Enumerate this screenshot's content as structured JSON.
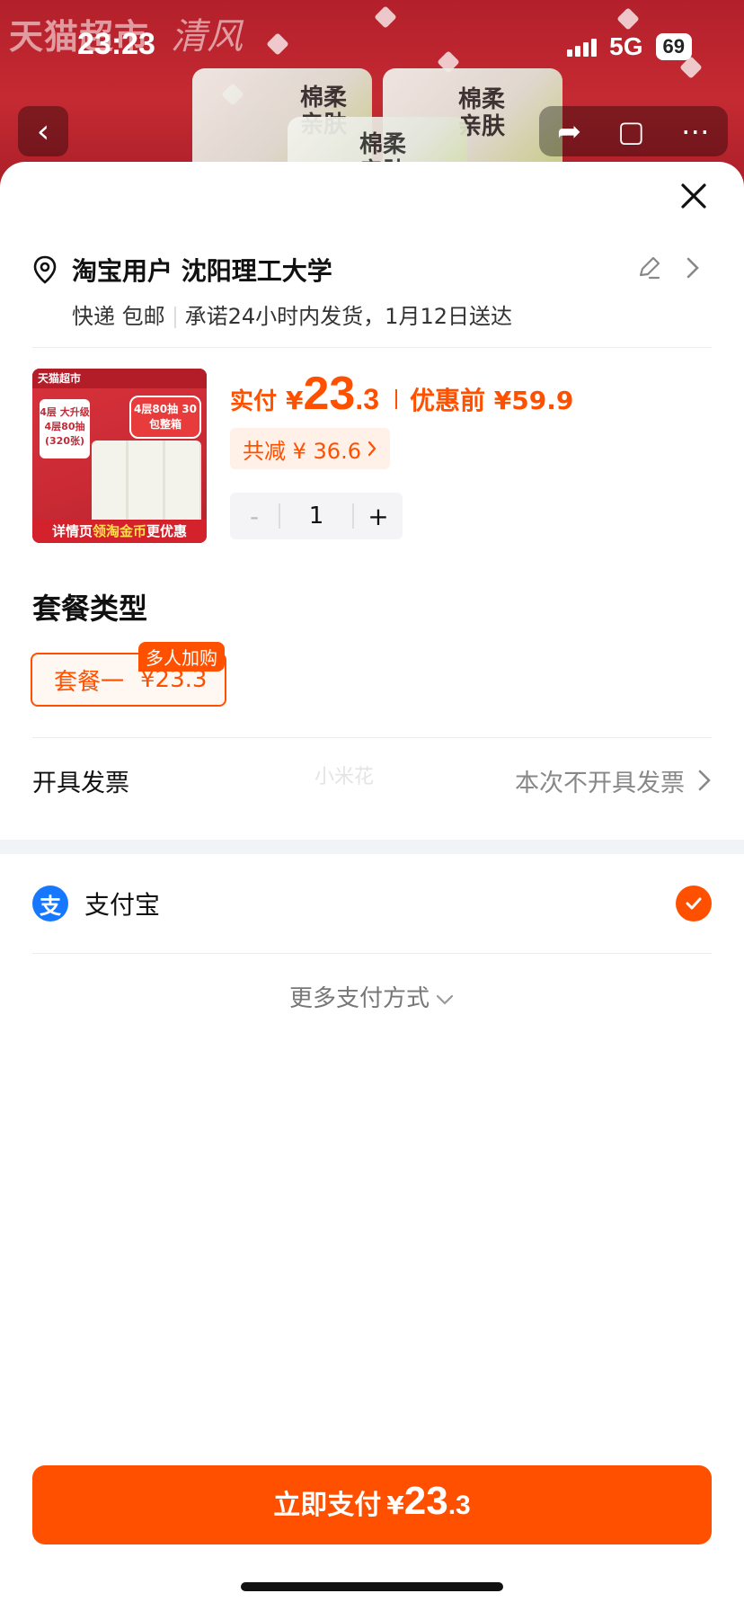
{
  "status_bar": {
    "time": "23:23",
    "network": "5G",
    "battery": "69"
  },
  "background": {
    "brand_text": "天猫超市",
    "brand_logo": "清风",
    "pack_labels": [
      "棉柔\n亲肤",
      "棉柔\n亲肤",
      "棉柔\n亲肤"
    ]
  },
  "address": {
    "name_line": "淘宝用户 沈阳理工大学",
    "shipping": "快递 包邮",
    "promise": "承诺24小时内发货，1月12日送达"
  },
  "product": {
    "image": {
      "top_text": "天猫超市",
      "badge_text": "4层 大升级 4层80抽 (320张)",
      "burst_text": "4层80抽 30包整箱",
      "footer_prefix": "详情页",
      "footer_highlight": "领淘金币",
      "footer_suffix": "更优惠"
    },
    "pay_label": "实付",
    "currency": "¥",
    "price_int": "23",
    "price_dec": ".3",
    "original_label": "优惠前 ¥59.9",
    "discount": "共减 ¥ 36.6",
    "quantity": "1",
    "minus": "-",
    "plus": "+"
  },
  "package": {
    "title": "套餐类型",
    "option_name": "套餐一",
    "option_price": "¥23.3",
    "tag": "多人加购"
  },
  "invoice": {
    "label": "开具发票",
    "value": "本次不开具发票",
    "watermark": "小米花"
  },
  "payment": {
    "method": "支付宝",
    "method_icon_text": "支",
    "more": "更多支付方式"
  },
  "pay_button": {
    "label": "立即支付",
    "currency": "¥",
    "amount_int": "23",
    "amount_dec": ".3"
  },
  "colors": {
    "accent": "#ff5000",
    "alipay": "#1677ff"
  },
  "icons": [
    "location-pin-icon",
    "edit-icon",
    "chevron-right-icon",
    "close-icon",
    "check-icon",
    "chevron-down-icon"
  ]
}
